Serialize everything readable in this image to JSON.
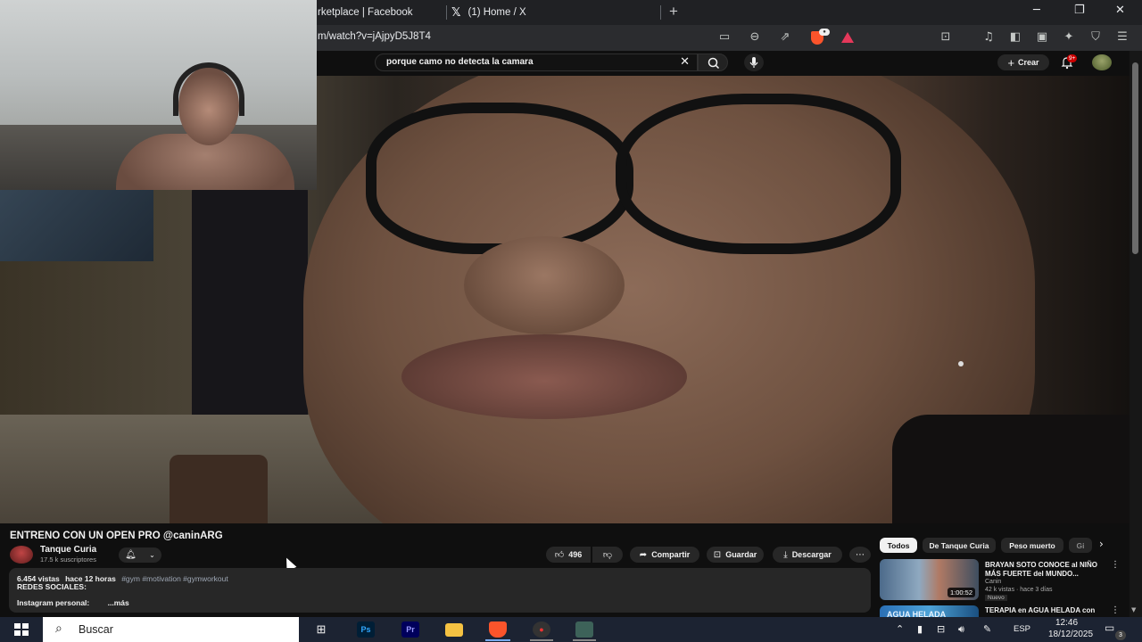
{
  "browser": {
    "tabs": [
      {
        "label": "rketplace | Facebook"
      },
      {
        "icon": "x-logo",
        "label": "(1) Home / X"
      }
    ],
    "new_tab_label": "+",
    "url": "m/watch?v=jAjpyD5J8T4"
  },
  "youtube": {
    "search_query": "porque camo no detecta la camara",
    "create_label": "Crear",
    "notification_badge": "9+"
  },
  "video": {
    "title": "ENTRENO CON UN OPEN PRO @caninARG",
    "channel_name": "Tanque Curia",
    "channel_subs": "17.5 k suscriptores",
    "likes": "496",
    "share_label": "Compartir",
    "save_label": "Guardar",
    "download_label": "Descargar",
    "description": {
      "views": "6.454 vistas",
      "age": "hace 12 horas",
      "tags": "#gym #motivation #gymworkout",
      "line2": "REDES SOCIALES:",
      "line3": "Instagram personal:",
      "more": "...más"
    }
  },
  "chips": [
    "Todos",
    "De Tanque Curia",
    "Peso muerto",
    "Gi"
  ],
  "recommended": [
    {
      "title": "BRAYAN SOTO CONOCE al NIÑO MÁS FUERTE del MUNDO...",
      "channel": "Canin",
      "meta": "42 k vistas · hace 3 días",
      "badge": "Nuevo",
      "duration": "1:00:52"
    },
    {
      "title": "TERAPIA en AGUA HELADA con SONSOS BANZIO",
      "thumb_text": "AGUA HELADA"
    }
  ],
  "taskbar": {
    "search_placeholder": "Buscar",
    "apps": [
      {
        "name": "task-view",
        "label": ""
      },
      {
        "name": "photoshop",
        "label": "Ps",
        "color": "#31a8ff",
        "bg": "#001e36"
      },
      {
        "name": "premiere",
        "label": "Pr",
        "color": "#9999ff",
        "bg": "#00005b"
      },
      {
        "name": "file-explorer",
        "label": "",
        "color": "#f5c242"
      },
      {
        "name": "brave",
        "label": "",
        "color": "#fb542b"
      },
      {
        "name": "app-2",
        "label": ""
      },
      {
        "name": "app-3",
        "label": ""
      }
    ],
    "language": "ESP",
    "time": "12:46",
    "date": "18/12/2025",
    "notification_count": "3"
  },
  "colors": {
    "yt_background": "#0f0f0f",
    "pill_background": "#272727",
    "taskbar": "#1c2332",
    "tab_bar": "#202124"
  }
}
